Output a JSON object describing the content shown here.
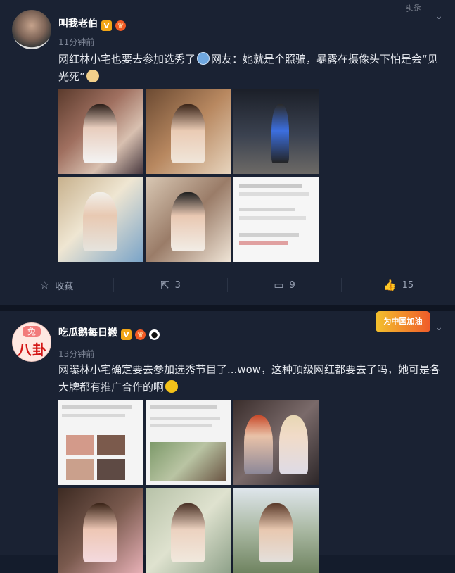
{
  "posts": [
    {
      "author": "叫我老伯",
      "time": "11分钟前",
      "text_part1": "网红林小宅也要去参加选秀了",
      "text_part2": "网友：她就是个照骗，暴露在摄像头下怕是会“见光死”",
      "actions": {
        "favorite_label": "收藏",
        "repost_count": "3",
        "comment_count": "9",
        "like_count": "15"
      },
      "stamp_text": "头条"
    },
    {
      "author": "吃瓜鹅每日搬",
      "time": "13分钟前",
      "text": "网曝林小宅确定要去参加选秀节目了...wow，这种顶级网红都要去了吗，她可是各大牌都有推广合作的啊",
      "avatar_top": "兔",
      "avatar_bottom": "八卦",
      "promo_text": "为中国加油"
    }
  ],
  "colors": {
    "background": "#141c2c",
    "card": "#1a2233",
    "text": "#e6e9ef",
    "muted": "#7d8596",
    "verified_badge": "#f2a516"
  },
  "icons": [
    "star-icon",
    "repost-icon",
    "comment-icon",
    "like-icon",
    "chevron-down-icon"
  ]
}
